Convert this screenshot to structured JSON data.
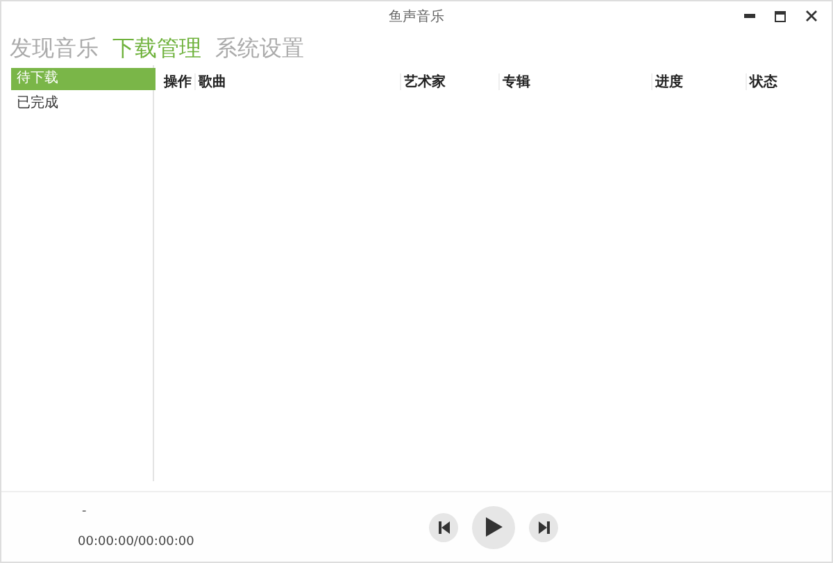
{
  "window": {
    "title": "鱼声音乐"
  },
  "tabs": [
    {
      "label": "发现音乐",
      "selected": false
    },
    {
      "label": "下载管理",
      "selected": true
    },
    {
      "label": "系统设置",
      "selected": false
    }
  ],
  "sidebar": {
    "items": [
      {
        "label": "待下载",
        "selected": true
      },
      {
        "label": "已完成",
        "selected": false
      }
    ]
  },
  "table": {
    "columns": [
      "操作",
      "歌曲",
      "艺术家",
      "专辑",
      "进度",
      "状态"
    ]
  },
  "player": {
    "track": "-",
    "time": "00:00:00/00:00:00"
  }
}
